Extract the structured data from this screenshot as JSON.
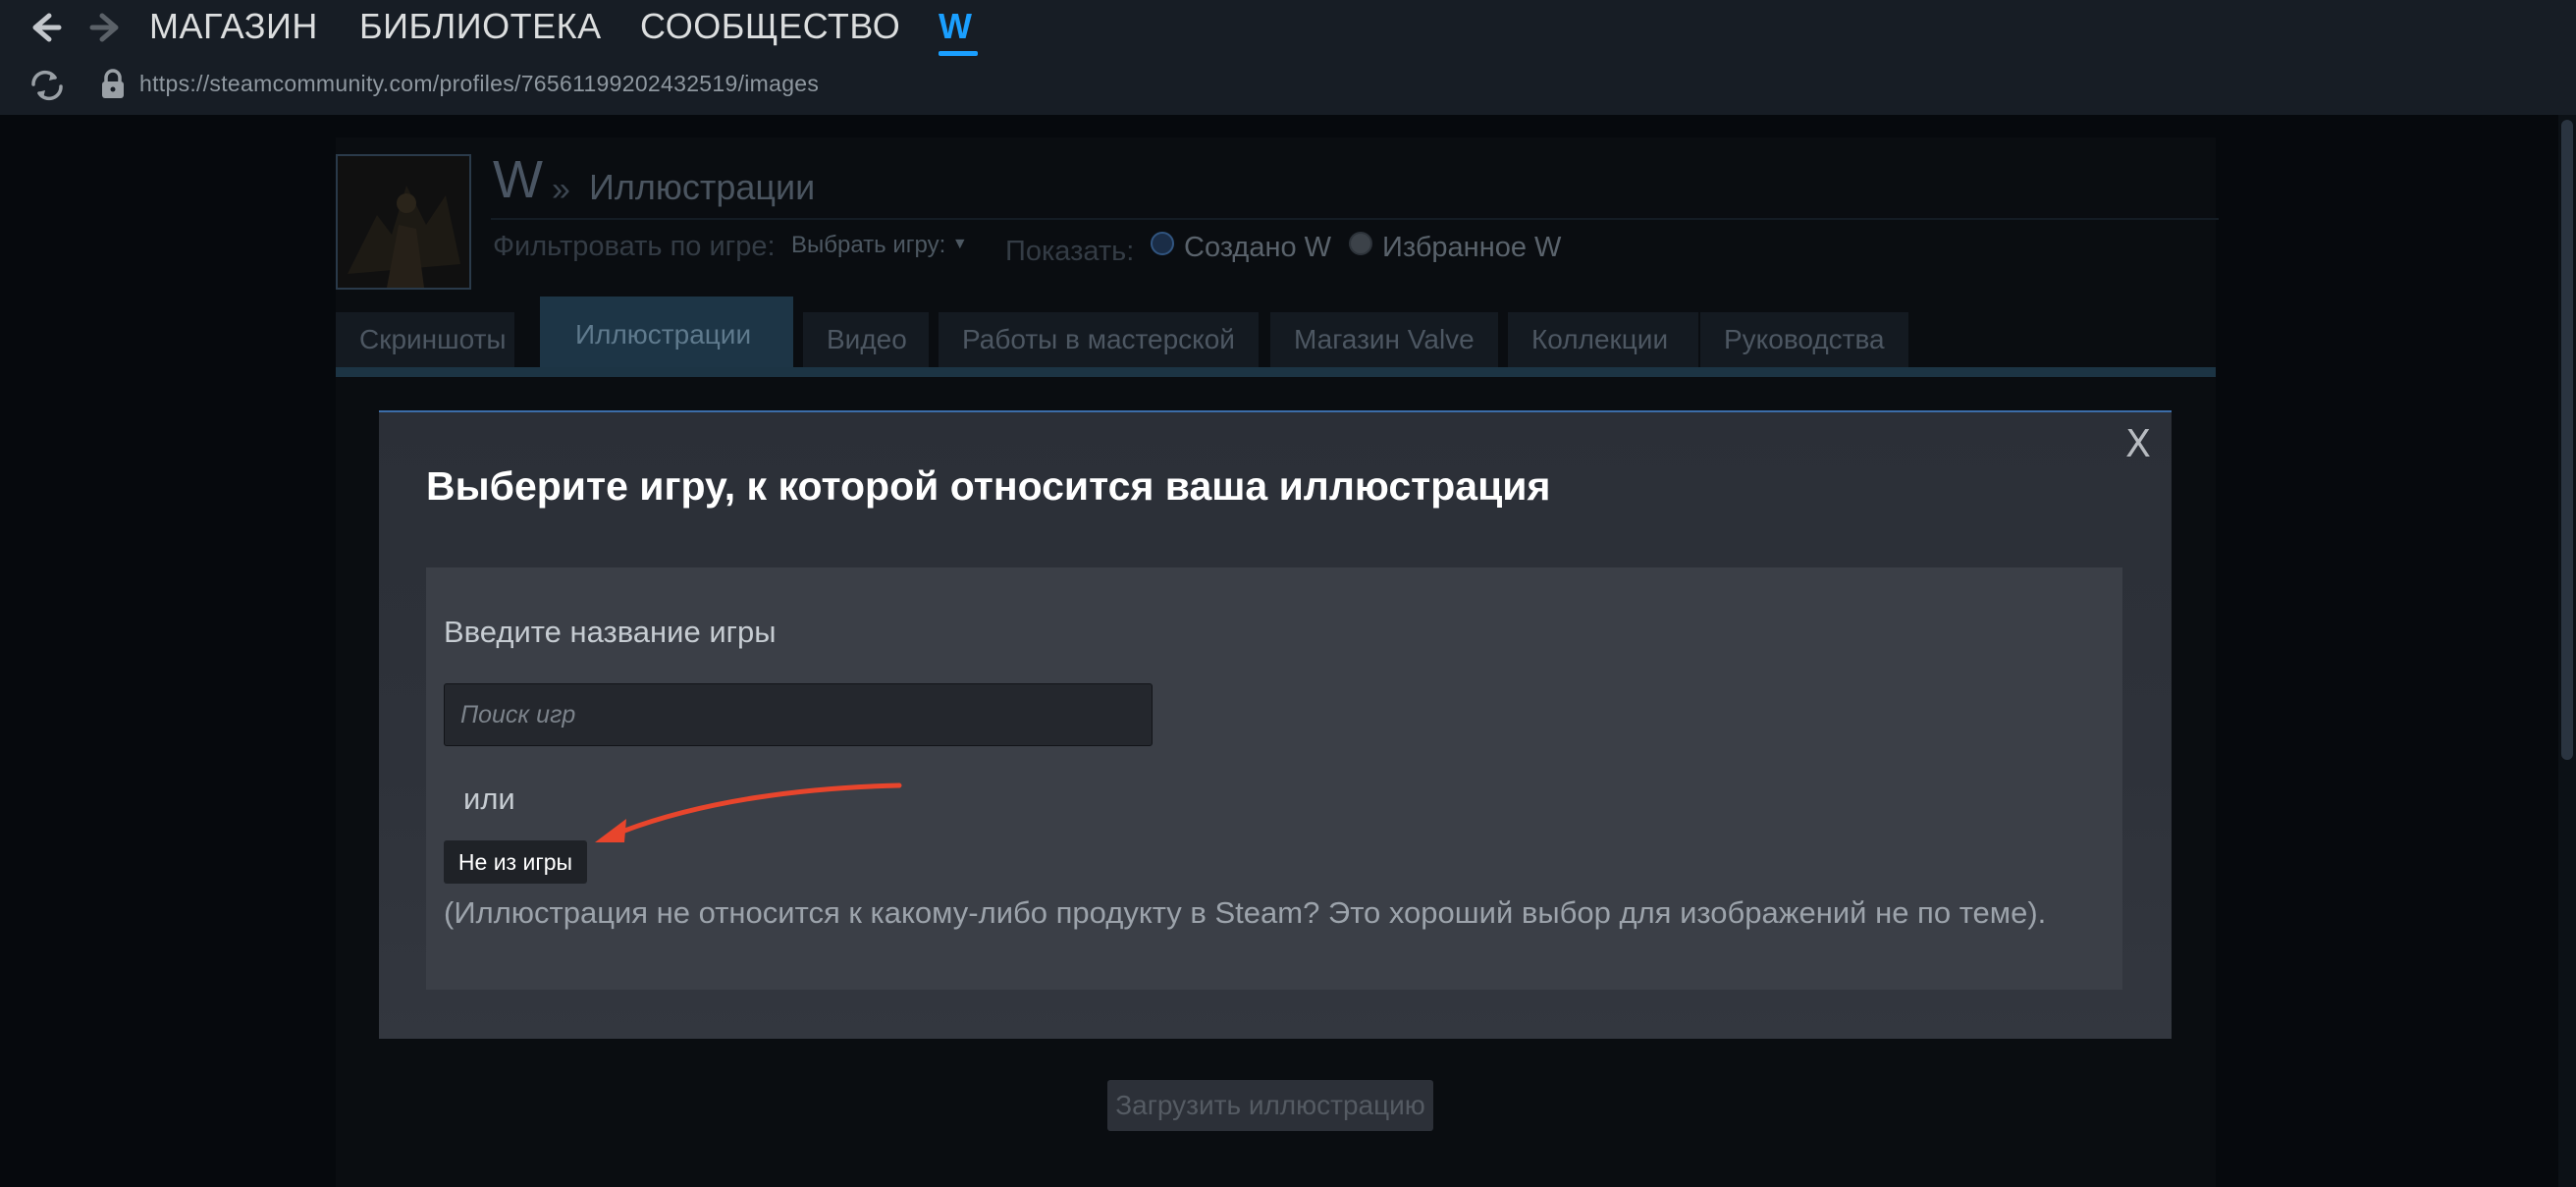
{
  "topnav": {
    "items": [
      "МАГАЗИН",
      "БИБЛИОТЕКА",
      "СООБЩЕСТВО",
      "W"
    ],
    "active_index": 3
  },
  "browser": {
    "url": "https://steamcommunity.com/profiles/76561199202432519/images"
  },
  "profile": {
    "name": "W",
    "separator": "»",
    "section_title": "Иллюстрации",
    "filter_label": "Фильтровать по игре:",
    "filter_select": "Выбрать игру:",
    "show_label": "Показать:",
    "radio_created": "Создано W",
    "radio_favorites": "Избранное W"
  },
  "tabs": [
    "Скриншоты",
    "Иллюстрации",
    "Видео",
    "Работы в мастерской",
    "Магазин Valve",
    "Коллекции",
    "Руководства"
  ],
  "background": {
    "upload_button": "Загрузить иллюстрацию"
  },
  "modal": {
    "close_symbol": "X",
    "title": "Выберите игру, к которой относится ваша иллюстрация",
    "search_label": "Введите название игры",
    "search_placeholder": "Поиск игр",
    "or_text": "или",
    "not_game_button": "Не из игры",
    "note": "(Иллюстрация не относится к какому-либо продукту в Steam? Это хороший выбор для изображений не по теме)."
  },
  "colors": {
    "accent": "#1a9fff",
    "annotation_arrow": "#e8452c",
    "modal_border": "#3c6da8"
  }
}
